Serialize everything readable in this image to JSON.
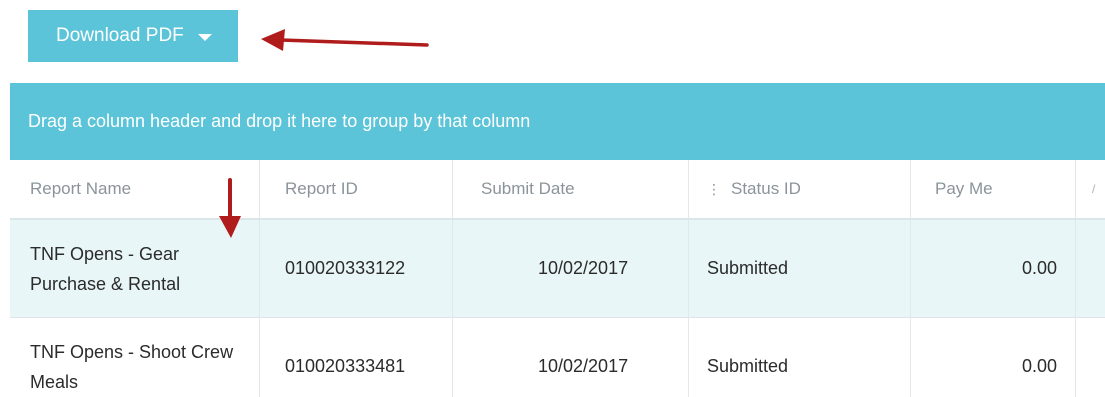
{
  "toolbar": {
    "download_label": "Download PDF",
    "download_icon": "chevron-down-icon"
  },
  "group_bar": {
    "text": "Drag a column header and drop it here to group by that column"
  },
  "grid": {
    "columns": [
      "Report Name",
      "Report ID",
      "Submit Date",
      "Status ID",
      "Pay Me"
    ],
    "rows": [
      {
        "report_name": "TNF Opens - Gear Purchase & Rental",
        "report_id": "010020333122",
        "submit_date": "10/02/2017",
        "status": "Submitted",
        "pay_me": "0.00"
      },
      {
        "report_name": "TNF Opens - Shoot Crew Meals",
        "report_id": "010020333481",
        "submit_date": "10/02/2017",
        "status": "Submitted",
        "pay_me": "0.00"
      }
    ]
  },
  "colors": {
    "accent": "#5bc4d9",
    "selected_row": "#e8f6f8",
    "annotation_arrow": "#b01c1c"
  }
}
